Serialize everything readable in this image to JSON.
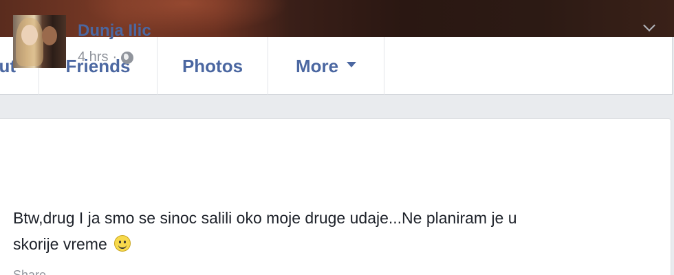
{
  "nav": {
    "tabs": [
      {
        "label": "ut"
      },
      {
        "label": "Friends"
      },
      {
        "label": "Photos"
      },
      {
        "label": "More"
      }
    ]
  },
  "post": {
    "author": "Dunja Ilic",
    "time": "4 hrs",
    "separator": "·",
    "text_line1": "Btw,drug I ja smo se sinoc salili oko moje druge udaje...Ne planiram je u",
    "text_line2": "skorije vreme",
    "action_share": "Share"
  },
  "colors": {
    "link_blue": "#4b67a1",
    "meta_gray": "#90949c",
    "background": "#e9ebee"
  },
  "icons": [
    "caret-down-icon",
    "globe-icon",
    "chevron-down-icon",
    "smiley-emoji-icon"
  ]
}
